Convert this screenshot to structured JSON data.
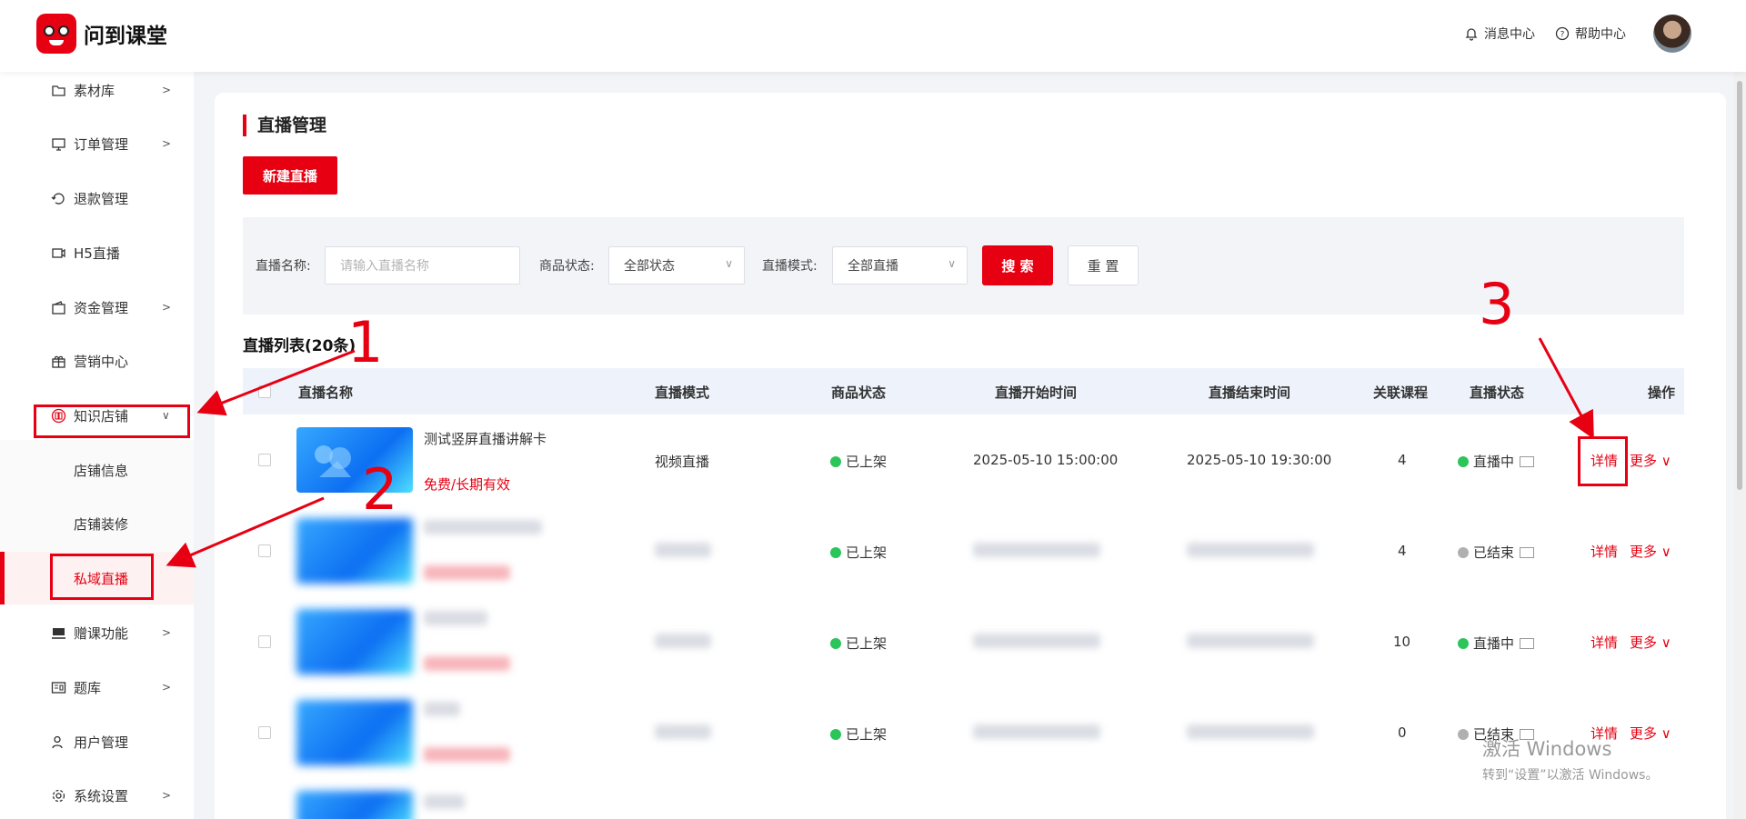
{
  "header": {
    "logo_text": "问到课堂",
    "messages": "消息中心",
    "help": "帮助中心"
  },
  "sidebar": {
    "items": [
      {
        "label": "素材库",
        "icon": "folder-icon",
        "chevron": true
      },
      {
        "label": "订单管理",
        "icon": "monitor-icon",
        "chevron": true
      },
      {
        "label": "退款管理",
        "icon": "refund-icon",
        "chevron": false
      },
      {
        "label": "H5直播",
        "icon": "video-icon",
        "chevron": false
      },
      {
        "label": "资金管理",
        "icon": "wallet-icon",
        "chevron": true
      },
      {
        "label": "营销中心",
        "icon": "gift-icon",
        "chevron": false
      },
      {
        "label": "知识店铺",
        "icon": "book-icon",
        "chevron": "down"
      },
      {
        "label": "店铺信息",
        "sub": true
      },
      {
        "label": "店铺装修",
        "sub": true
      },
      {
        "label": "私域直播",
        "sub": true,
        "active": true
      },
      {
        "label": "赠课功能",
        "icon": "gift-course-icon",
        "chevron": true
      },
      {
        "label": "题库",
        "icon": "question-bank-icon",
        "chevron": true
      },
      {
        "label": "用户管理",
        "icon": "user-icon",
        "chevron": false
      },
      {
        "label": "系统设置",
        "icon": "gear-icon",
        "chevron": true
      }
    ]
  },
  "page": {
    "title": "直播管理",
    "new_button": "新建直播"
  },
  "filters": {
    "name_label": "直播名称:",
    "name_placeholder": "请输入直播名称",
    "status_label": "商品状态:",
    "status_value": "全部状态",
    "mode_label": "直播模式:",
    "mode_value": "全部直播",
    "search": "搜 索",
    "reset": "重 置"
  },
  "list": {
    "title": "直播列表(20条)",
    "columns": [
      "直播名称",
      "直播模式",
      "商品状态",
      "直播开始时间",
      "直播结束时间",
      "关联课程",
      "直播状态",
      "操作"
    ],
    "rows": [
      {
        "name": "测试竖屏直播讲解卡",
        "price": "免费/长期有效",
        "mode": "视频直播",
        "goods_status": "已上架",
        "start": "2025-05-10 15:00:00",
        "end": "2025-05-10 19:30:00",
        "courses": "4",
        "live_status": "直播中",
        "live_color": "#2cc55a",
        "detail": "详情",
        "more": "更多"
      },
      {
        "goods_status": "已上架",
        "courses": "4",
        "live_status": "已结束",
        "live_color": "#b0b0b0",
        "detail": "详情",
        "more": "更多"
      },
      {
        "goods_status": "已上架",
        "courses": "10",
        "live_status": "直播中",
        "live_color": "#2cc55a",
        "detail": "详情",
        "more": "更多"
      },
      {
        "goods_status": "已上架",
        "courses": "0",
        "live_status": "已结束",
        "live_color": "#b0b0b0",
        "detail": "详情",
        "more": "更多"
      }
    ]
  },
  "annotations": [
    "1",
    "2",
    "3"
  ],
  "watermark": {
    "line1": "激活 Windows",
    "line2": "转到“设置”以激活 Windows。"
  },
  "colors": {
    "accent": "#e60012",
    "green": "#2cc55a",
    "grey": "#b0b0b0"
  }
}
